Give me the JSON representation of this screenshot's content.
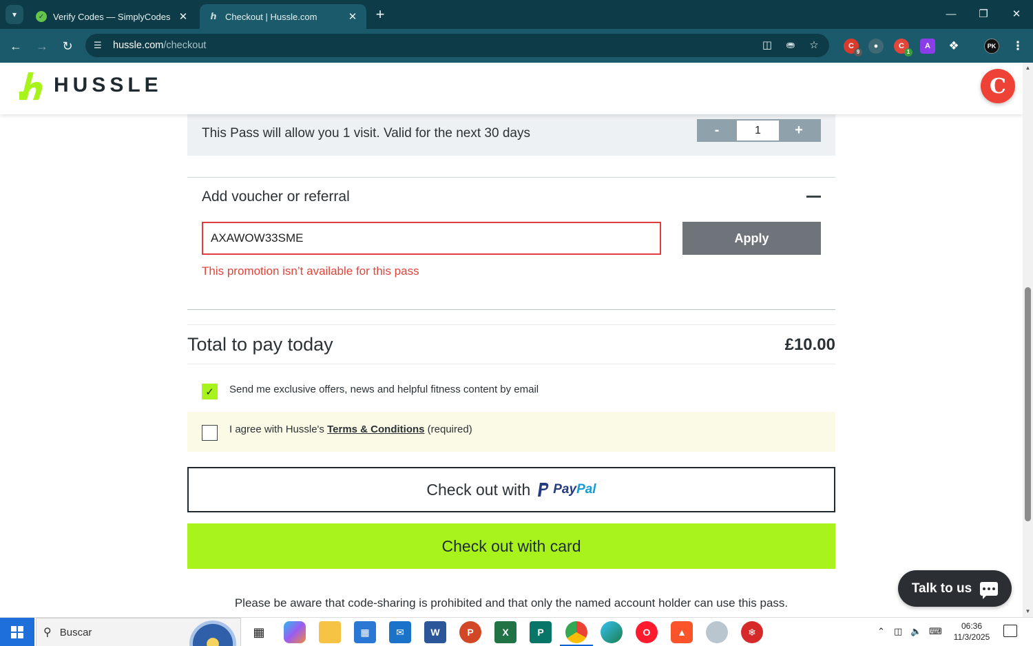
{
  "browser": {
    "tabs": [
      {
        "title": "Verify Codes — SimplyCodes",
        "active": false
      },
      {
        "title": "Checkout | Hussle.com",
        "active": true
      }
    ],
    "url_host": "hussle.com",
    "url_path": "/checkout",
    "extension_badges": {
      "ext1": "9",
      "ext3": "1"
    },
    "profile_initials": "PK"
  },
  "header": {
    "logo_text": "HUSSLE"
  },
  "pass": {
    "description": "This Pass will allow you 1 visit. Valid for the next 30 days",
    "quantity": "1",
    "decrement_label": "-",
    "increment_label": "+"
  },
  "voucher": {
    "title": "Add voucher or referral",
    "code_value": "AXAWOW33SME",
    "apply_label": "Apply",
    "error": "This promotion isn’t available for this pass"
  },
  "total": {
    "label": "Total to pay today",
    "amount": "£10.00"
  },
  "consents": {
    "offers_label": "Send me exclusive offers, news and helpful fitness content by email",
    "offers_checked": true,
    "terms_prefix": "I agree with Hussle's ",
    "terms_link": "Terms & Conditions",
    "terms_suffix": " (required)",
    "terms_checked": false
  },
  "checkout": {
    "paypal_label": "Check out with",
    "paypal_brand_pay": "Pay",
    "paypal_brand_pal": "Pal",
    "card_label": "Check out with card",
    "disclaimer": "Please be aware that code-sharing is prohibited and that only the named account holder can use this pass."
  },
  "chat": {
    "label": "Talk to us"
  },
  "taskbar": {
    "search_label": "Buscar",
    "time": "06:36",
    "date": "11/3/2025"
  },
  "colors": {
    "brand_lime": "#a8f31c",
    "chrome_dark": "#0d3b47",
    "chrome_toolbar": "#1b5a6a",
    "error_red": "#e03c3c"
  }
}
